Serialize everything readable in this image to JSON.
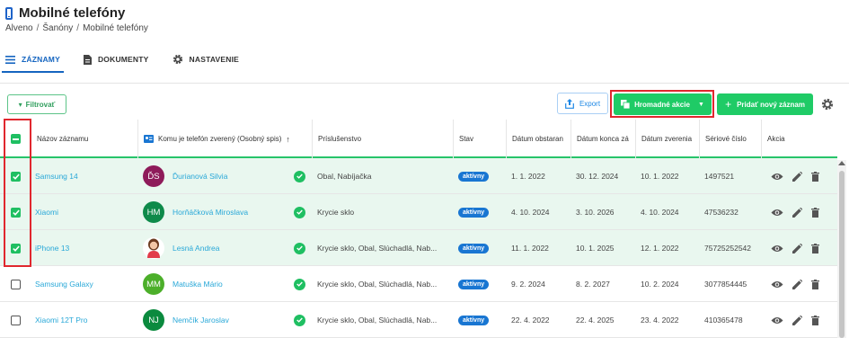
{
  "header": {
    "title": "Mobilné telefóny",
    "breadcrumb": [
      "Alveno",
      "Šanóny",
      "Mobilné telefóny"
    ]
  },
  "tabs": [
    {
      "label": "ZÁZNAMY",
      "icon": "list-icon",
      "active": true
    },
    {
      "label": "DOKUMENTY",
      "icon": "document-icon",
      "active": false
    },
    {
      "label": "NASTAVENIE",
      "icon": "gear-icon",
      "active": false
    }
  ],
  "toolbar": {
    "filter_label": "Filtrovať",
    "export_label": "Export",
    "mass_actions_label": "Hromadné akcie",
    "add_label": "Pridať nový záznam"
  },
  "columns": {
    "name": "Názov záznamu",
    "owner": "Komu je telefón zverený (Osobný spis)",
    "accessories": "Príslušenstvo",
    "status": "Stav",
    "acquired": "Dátum obstaran",
    "end": "Dátum konca zá",
    "assigned": "Dátum zverenia",
    "serial": "Sériové číslo",
    "actions": "Akcia"
  },
  "rows": [
    {
      "name": "Samsung 14",
      "initials": "ĎS",
      "avatar_color": "#8e1b5a",
      "owner": "Ďurianová Silvia",
      "accessories": "Obal, Nabíjačka",
      "status": "aktívny",
      "acquired": "1. 1. 2022",
      "end": "30. 12. 2024",
      "assigned": "10. 1. 2022",
      "serial": "1497521",
      "selected": true
    },
    {
      "name": "Xiaomi",
      "initials": "HM",
      "avatar_color": "#0e8a4a",
      "owner": "Horňáčková Miroslava",
      "accessories": "Krycie sklo",
      "status": "aktívny",
      "acquired": "4. 10. 2024",
      "end": "3. 10. 2026",
      "assigned": "4. 10. 2024",
      "serial": "47536232",
      "selected": true
    },
    {
      "name": "iPhone 13",
      "initials": "",
      "avatar_color": "#ffffff",
      "owner": "Lesná Andrea",
      "accessories": "Krycie sklo, Obal, Slúchadlá, Nab...",
      "status": "aktívny",
      "acquired": "11. 1. 2022",
      "end": "10. 1. 2025",
      "assigned": "12. 1. 2022",
      "serial": "75725252542",
      "selected": true
    },
    {
      "name": "Samsung Galaxy",
      "initials": "MM",
      "avatar_color": "#4caf2a",
      "owner": "Matuška Mário",
      "accessories": "Krycie sklo, Obal, Slúchadlá, Nab...",
      "status": "aktívny",
      "acquired": "9. 2. 2024",
      "end": "8. 2. 2027",
      "assigned": "10. 2. 2024",
      "serial": "3077854445",
      "selected": false
    },
    {
      "name": "Xiaomi 12T Pro",
      "initials": "NJ",
      "avatar_color": "#0b8a3e",
      "owner": "Nemčík Jaroslav",
      "accessories": "Krycie sklo, Obal, Slúchadlá, Nab...",
      "status": "aktívny",
      "acquired": "22. 4. 2022",
      "end": "22. 4. 2025",
      "assigned": "23. 4. 2022",
      "serial": "410365478",
      "selected": false
    }
  ],
  "colors": {
    "accent_green": "#1fcb66",
    "link_blue": "#29a8d8",
    "primary_blue": "#1565c0",
    "highlight_red": "#e0272e"
  }
}
